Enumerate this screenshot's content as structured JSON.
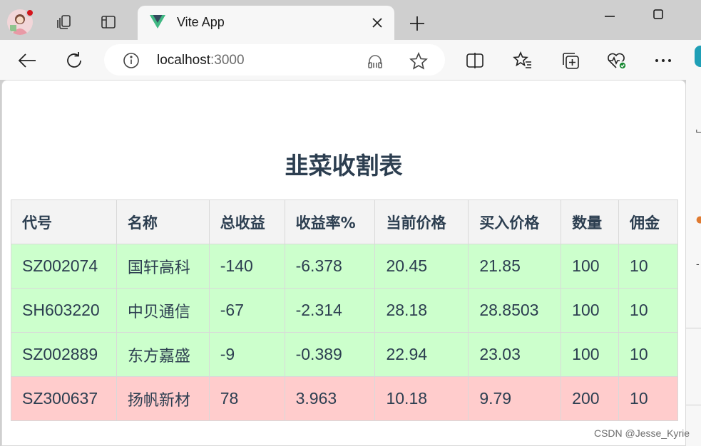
{
  "tab": {
    "title": "Vite App"
  },
  "address_bar": {
    "host": "localhost",
    "port": ":3000"
  },
  "page": {
    "title": "韭菜收割表",
    "columns": [
      "代号",
      "名称",
      "总收益",
      "收益率%",
      "当前价格",
      "买入价格",
      "数量",
      "佣金"
    ],
    "rows": [
      {
        "status": "loss",
        "cells": [
          "SZ002074",
          "国轩高科",
          "-140",
          "-6.378",
          "20.45",
          "21.85",
          "100",
          "10"
        ]
      },
      {
        "status": "loss",
        "cells": [
          "SH603220",
          "中贝通信",
          "-67",
          "-2.314",
          "28.18",
          "28.8503",
          "100",
          "10"
        ]
      },
      {
        "status": "loss",
        "cells": [
          "SZ002889",
          "东方嘉盛",
          "-9",
          "-0.389",
          "22.94",
          "23.03",
          "100",
          "10"
        ]
      },
      {
        "status": "gain",
        "cells": [
          "SZ300637",
          "扬帆新材",
          "78",
          "3.963",
          "10.18",
          "9.79",
          "200",
          "10"
        ]
      }
    ]
  },
  "watermark": "CSDN @Jesse_Kyrie",
  "colors": {
    "loss_row": "#ccffcc",
    "gain_row": "#ffcccc",
    "title_text": "#2c3e50",
    "vite_green": "#41b883"
  },
  "icons": {
    "tabstrip": [
      "profile-avatar",
      "workspaces-icon",
      "vertical-tabs-icon",
      "vite-favicon",
      "close-icon",
      "plus-icon",
      "minimize-icon",
      "maximize-icon"
    ],
    "toolbar": [
      "back-arrow-icon",
      "refresh-icon",
      "info-icon",
      "read-aloud-icon",
      "favorite-star-icon",
      "split-screen-icon",
      "favorites-icon",
      "collections-icon",
      "browser-essentials-icon",
      "more-icon"
    ]
  }
}
